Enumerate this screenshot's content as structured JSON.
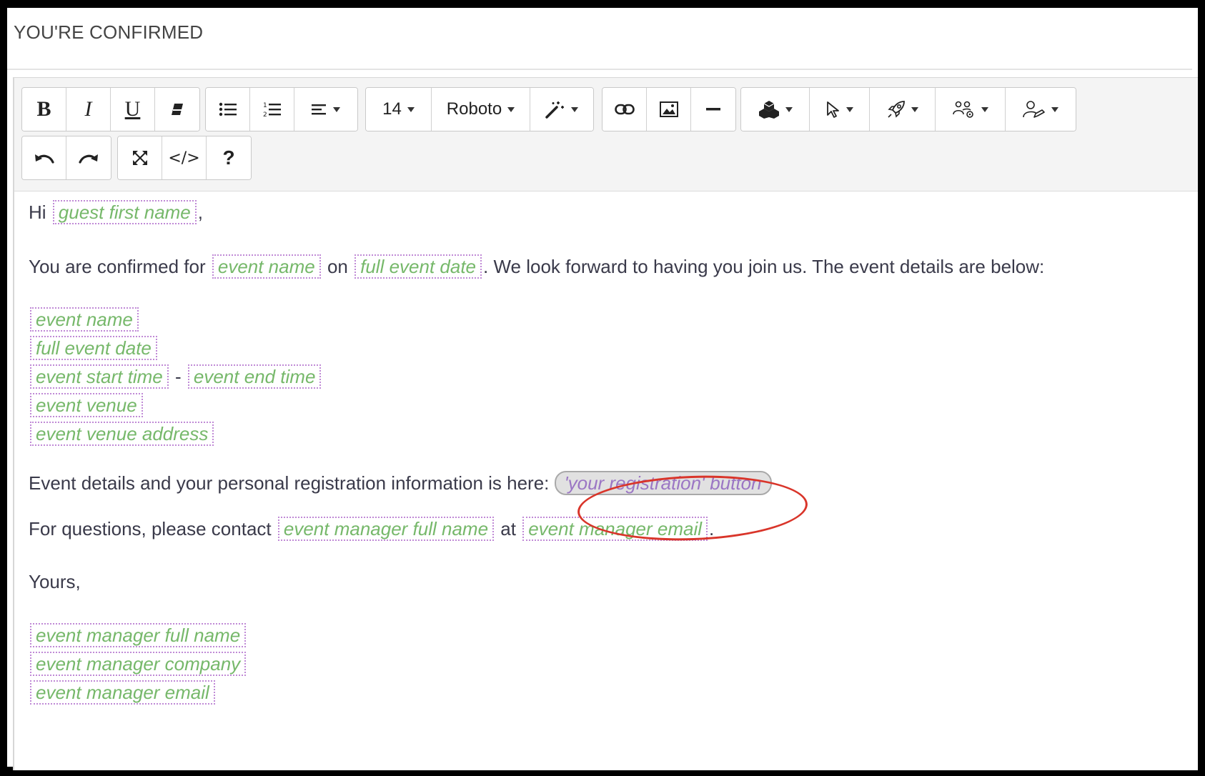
{
  "subject": "YOU'RE CONFIRMED",
  "toolbar": {
    "font_size": "14",
    "font_family": "Roboto"
  },
  "body": {
    "greeting": "Hi",
    "greeting_comma": ",",
    "confirm_text_1": "You are confirmed for",
    "confirm_text_on": "on",
    "confirm_text_2": ". We look forward to having you join us. The event details are below:",
    "dash": "-",
    "registration_text": "Event details and your personal registration information is here:",
    "questions_text": "For questions, please contact",
    "questions_at": "at",
    "questions_period": ".",
    "closing": "Yours,"
  },
  "placeholders": {
    "guest_first_name": "guest first name",
    "event_name": "event name",
    "full_event_date": "full event date",
    "event_start_time": "event start time",
    "event_end_time": "event end time",
    "event_venue": "event venue",
    "event_venue_address": "event venue address",
    "registration_button": "'your registration' button",
    "event_manager_full_name": "event manager full name",
    "event_manager_email": "event manager email",
    "event_manager_company": "event manager company"
  },
  "colors": {
    "placeholder_text": "#76b86a",
    "placeholder_border": "#c08ad6",
    "annotation_circle": "#d9352a"
  }
}
